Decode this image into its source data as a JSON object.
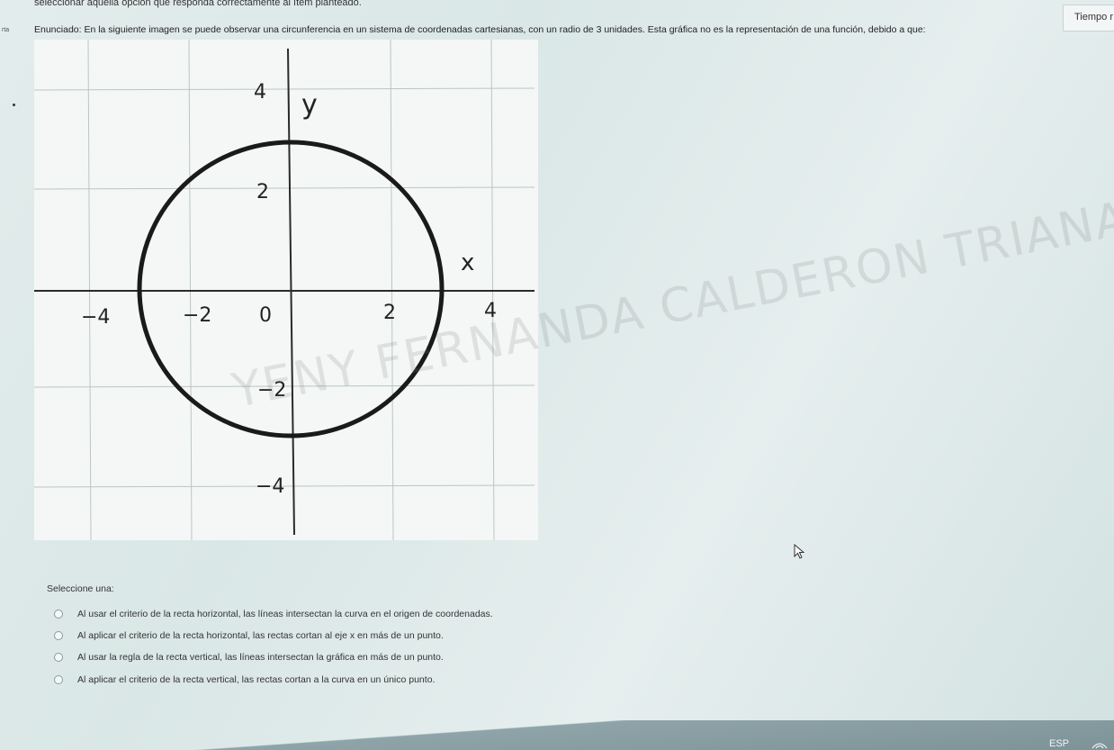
{
  "header": {
    "instruction": "seleccionar aquella opción que responda correctamente al ítem planteado.",
    "side_label": "rta",
    "statement": "Enunciado: En la siguiente imagen se puede observar una circunferencia en un sistema de coordenadas cartesianas, con un radio de 3 unidades. Esta gráfica no es la representación de una función, debido a que:",
    "timer_label": "Tiempo r"
  },
  "graph": {
    "y_axis_label": "y",
    "x_axis_label": "x",
    "x_tick_labels": [
      "−4",
      "−2",
      "0",
      "2",
      "4"
    ],
    "y_tick_labels": [
      "4",
      "2",
      "−2",
      "−4"
    ],
    "circle_color": "#1a1a1a",
    "grid_color": "#b9c6c6"
  },
  "watermark": "YENY FERNANDA CALDERON TRIANA",
  "question": {
    "select_label": "Seleccione una:",
    "options": [
      "Al usar el criterio de la recta horizontal, las líneas intersectan la curva en el origen de coordenadas.",
      "Al aplicar el criterio de la recta horizontal, las rectas cortan al eje x en más de un punto.",
      "Al usar la regla de la recta vertical, las líneas intersectan la gráfica en más de un punto.",
      "Al aplicar el criterio de la recta vertical, las rectas cortan a la curva en un único punto."
    ]
  },
  "taskbar": {
    "language": "ESP"
  }
}
